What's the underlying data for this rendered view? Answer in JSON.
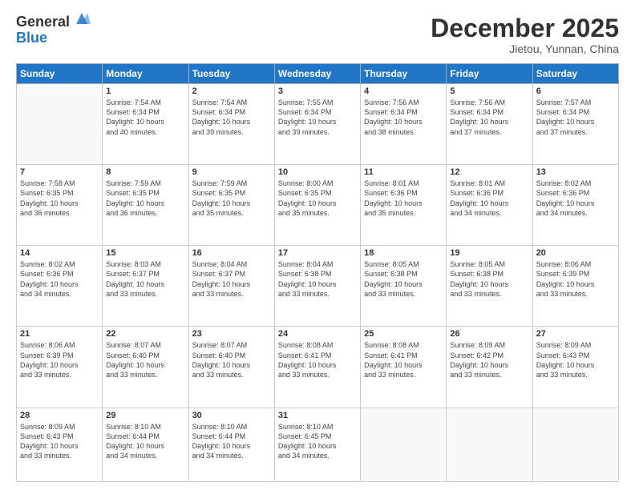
{
  "logo": {
    "general": "General",
    "blue": "Blue"
  },
  "header": {
    "month": "December 2025",
    "location": "Jietou, Yunnan, China"
  },
  "days": [
    "Sunday",
    "Monday",
    "Tuesday",
    "Wednesday",
    "Thursday",
    "Friday",
    "Saturday"
  ],
  "weeks": [
    [
      {
        "day": "",
        "info": ""
      },
      {
        "day": "1",
        "info": "Sunrise: 7:54 AM\nSunset: 6:34 PM\nDaylight: 10 hours\nand 40 minutes."
      },
      {
        "day": "2",
        "info": "Sunrise: 7:54 AM\nSunset: 6:34 PM\nDaylight: 10 hours\nand 39 minutes."
      },
      {
        "day": "3",
        "info": "Sunrise: 7:55 AM\nSunset: 6:34 PM\nDaylight: 10 hours\nand 39 minutes."
      },
      {
        "day": "4",
        "info": "Sunrise: 7:56 AM\nSunset: 6:34 PM\nDaylight: 10 hours\nand 38 minutes."
      },
      {
        "day": "5",
        "info": "Sunrise: 7:56 AM\nSunset: 6:34 PM\nDaylight: 10 hours\nand 37 minutes."
      },
      {
        "day": "6",
        "info": "Sunrise: 7:57 AM\nSunset: 6:34 PM\nDaylight: 10 hours\nand 37 minutes."
      }
    ],
    [
      {
        "day": "7",
        "info": "Sunrise: 7:58 AM\nSunset: 6:35 PM\nDaylight: 10 hours\nand 36 minutes."
      },
      {
        "day": "8",
        "info": "Sunrise: 7:59 AM\nSunset: 6:35 PM\nDaylight: 10 hours\nand 36 minutes."
      },
      {
        "day": "9",
        "info": "Sunrise: 7:59 AM\nSunset: 6:35 PM\nDaylight: 10 hours\nand 35 minutes."
      },
      {
        "day": "10",
        "info": "Sunrise: 8:00 AM\nSunset: 6:35 PM\nDaylight: 10 hours\nand 35 minutes."
      },
      {
        "day": "11",
        "info": "Sunrise: 8:01 AM\nSunset: 6:36 PM\nDaylight: 10 hours\nand 35 minutes."
      },
      {
        "day": "12",
        "info": "Sunrise: 8:01 AM\nSunset: 6:36 PM\nDaylight: 10 hours\nand 34 minutes."
      },
      {
        "day": "13",
        "info": "Sunrise: 8:02 AM\nSunset: 6:36 PM\nDaylight: 10 hours\nand 34 minutes."
      }
    ],
    [
      {
        "day": "14",
        "info": "Sunrise: 8:02 AM\nSunset: 6:36 PM\nDaylight: 10 hours\nand 34 minutes."
      },
      {
        "day": "15",
        "info": "Sunrise: 8:03 AM\nSunset: 6:37 PM\nDaylight: 10 hours\nand 33 minutes."
      },
      {
        "day": "16",
        "info": "Sunrise: 8:04 AM\nSunset: 6:37 PM\nDaylight: 10 hours\nand 33 minutes."
      },
      {
        "day": "17",
        "info": "Sunrise: 8:04 AM\nSunset: 6:38 PM\nDaylight: 10 hours\nand 33 minutes."
      },
      {
        "day": "18",
        "info": "Sunrise: 8:05 AM\nSunset: 6:38 PM\nDaylight: 10 hours\nand 33 minutes."
      },
      {
        "day": "19",
        "info": "Sunrise: 8:05 AM\nSunset: 6:38 PM\nDaylight: 10 hours\nand 33 minutes."
      },
      {
        "day": "20",
        "info": "Sunrise: 8:06 AM\nSunset: 6:39 PM\nDaylight: 10 hours\nand 33 minutes."
      }
    ],
    [
      {
        "day": "21",
        "info": "Sunrise: 8:06 AM\nSunset: 6:39 PM\nDaylight: 10 hours\nand 33 minutes."
      },
      {
        "day": "22",
        "info": "Sunrise: 8:07 AM\nSunset: 6:40 PM\nDaylight: 10 hours\nand 33 minutes."
      },
      {
        "day": "23",
        "info": "Sunrise: 8:07 AM\nSunset: 6:40 PM\nDaylight: 10 hours\nand 33 minutes."
      },
      {
        "day": "24",
        "info": "Sunrise: 8:08 AM\nSunset: 6:41 PM\nDaylight: 10 hours\nand 33 minutes."
      },
      {
        "day": "25",
        "info": "Sunrise: 8:08 AM\nSunset: 6:41 PM\nDaylight: 10 hours\nand 33 minutes."
      },
      {
        "day": "26",
        "info": "Sunrise: 8:09 AM\nSunset: 6:42 PM\nDaylight: 10 hours\nand 33 minutes."
      },
      {
        "day": "27",
        "info": "Sunrise: 8:09 AM\nSunset: 6:43 PM\nDaylight: 10 hours\nand 33 minutes."
      }
    ],
    [
      {
        "day": "28",
        "info": "Sunrise: 8:09 AM\nSunset: 6:43 PM\nDaylight: 10 hours\nand 33 minutes."
      },
      {
        "day": "29",
        "info": "Sunrise: 8:10 AM\nSunset: 6:44 PM\nDaylight: 10 hours\nand 34 minutes."
      },
      {
        "day": "30",
        "info": "Sunrise: 8:10 AM\nSunset: 6:44 PM\nDaylight: 10 hours\nand 34 minutes."
      },
      {
        "day": "31",
        "info": "Sunrise: 8:10 AM\nSunset: 6:45 PM\nDaylight: 10 hours\nand 34 minutes."
      },
      {
        "day": "",
        "info": ""
      },
      {
        "day": "",
        "info": ""
      },
      {
        "day": "",
        "info": ""
      }
    ]
  ]
}
